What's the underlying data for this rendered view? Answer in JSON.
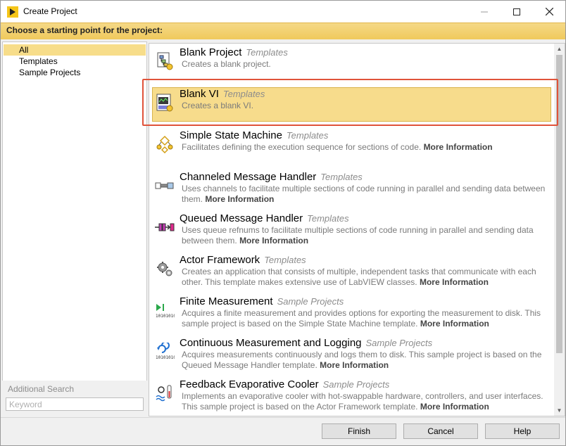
{
  "window": {
    "title": "Create Project",
    "controls": {
      "minimize": "—",
      "maximize": "☐",
      "close": "✕"
    }
  },
  "header": {
    "prompt": "Choose a starting point for the project:"
  },
  "categories": [
    {
      "label": "All",
      "selected": true
    },
    {
      "label": "Templates",
      "selected": false
    },
    {
      "label": "Sample Projects",
      "selected": false
    }
  ],
  "search": {
    "label": "Additional Search",
    "placeholder": "Keyword",
    "value": ""
  },
  "templates": [
    {
      "title": "Blank Project",
      "category": "Templates",
      "desc": "Creates a blank project.",
      "more": "",
      "icon": "project-icon",
      "selected": false
    },
    {
      "title": "Blank VI",
      "category": "Templates",
      "desc": "Creates a blank VI.",
      "more": "",
      "icon": "vi-icon",
      "selected": true
    },
    {
      "title": "Simple State Machine",
      "category": "Templates",
      "desc": "Facilitates defining the execution sequence for sections of code.",
      "more": "More Information",
      "icon": "state-machine-icon",
      "selected": false
    },
    {
      "title": "Channeled Message Handler",
      "category": "Templates",
      "desc": "Uses channels to facilitate multiple sections of code running in parallel and sending data between them.",
      "more": "More Information",
      "icon": "channel-icon",
      "selected": false
    },
    {
      "title": "Queued Message Handler",
      "category": "Templates",
      "desc": "Uses queue refnums to facilitate multiple sections of code running in parallel and sending data between them.",
      "more": "More Information",
      "icon": "queue-icon",
      "selected": false
    },
    {
      "title": "Actor Framework",
      "category": "Templates",
      "desc": "Creates an application that consists of multiple, independent tasks that communicate with each other. This template makes extensive use of LabVIEW classes.",
      "more": "More Information",
      "icon": "gears-icon",
      "selected": false
    },
    {
      "title": "Finite Measurement",
      "category": "Sample Projects",
      "desc": "Acquires a finite measurement and provides options for exporting the measurement to disk. This sample project is based on the Simple State Machine template.",
      "more": "More Information",
      "icon": "finite-measurement-icon",
      "selected": false
    },
    {
      "title": "Continuous Measurement and Logging",
      "category": "Sample Projects",
      "desc": "Acquires measurements continuously and logs them to disk. This sample project is based on the Queued Message Handler template.",
      "more": "More Information",
      "icon": "continuous-measurement-icon",
      "selected": false
    },
    {
      "title": "Feedback Evaporative Cooler",
      "category": "Sample Projects",
      "desc": "Implements an evaporative cooler with hot-swappable hardware, controllers, and user interfaces. This sample project is based on the Actor Framework template.",
      "more": "More Information",
      "icon": "cooler-icon",
      "selected": false
    }
  ],
  "buttons": {
    "finish": "Finish",
    "cancel": "Cancel",
    "help": "Help"
  },
  "colors": {
    "header_accent": "#f0c95c",
    "selection": "#f7dc8c",
    "highlight_border": "#e0533a"
  }
}
